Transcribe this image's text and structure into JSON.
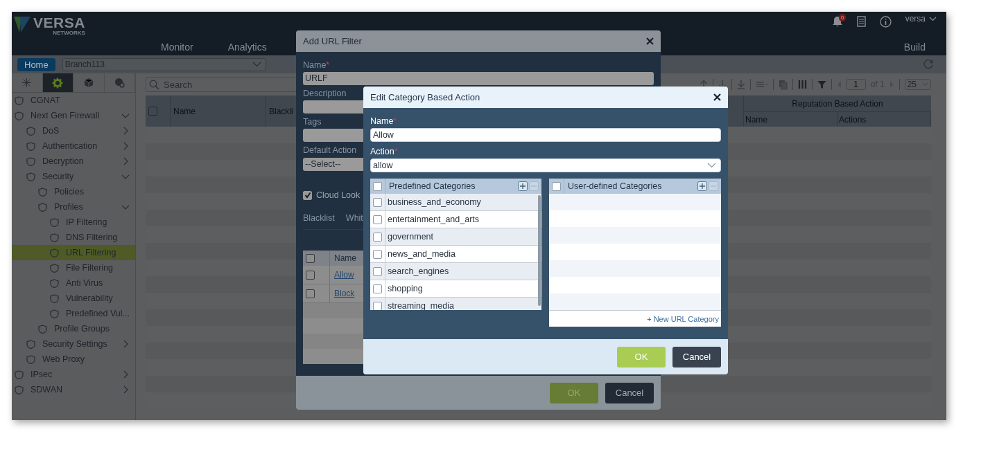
{
  "header": {
    "logo": {
      "wordmark": "VERSA",
      "tagline": "NETWORKS"
    },
    "nav": [
      "Monitor",
      "Analytics"
    ],
    "nav_end": "Build",
    "notifications": "0",
    "user": "versa"
  },
  "toolbar": {
    "home": "Home",
    "branch": "Branch113"
  },
  "sidebar": {
    "tabs": [
      {
        "kind": "network",
        "selected": false
      },
      {
        "kind": "gear",
        "selected": true
      },
      {
        "kind": "cube",
        "selected": false
      },
      {
        "kind": "globe",
        "selected": false
      }
    ],
    "items": [
      {
        "label": "CGNAT",
        "selected": false
      },
      {
        "label": "Next Gen Firewall",
        "selected": false,
        "expanded": true,
        "children": [
          {
            "label": "DoS",
            "selected": false,
            "expanded": false
          },
          {
            "label": "Authentication",
            "selected": false,
            "expanded": false
          },
          {
            "label": "Decryption",
            "selected": false,
            "expanded": false
          },
          {
            "label": "Security",
            "selected": false,
            "expanded": true,
            "children": [
              {
                "label": "Policies",
                "selected": false
              },
              {
                "label": "Profiles",
                "selected": false,
                "expanded": true,
                "children": [
                  {
                    "label": "IP Filtering",
                    "selected": false
                  },
                  {
                    "label": "DNS Filtering",
                    "selected": false
                  },
                  {
                    "label": "URL Filtering",
                    "selected": true
                  },
                  {
                    "label": "File Filtering",
                    "selected": false
                  },
                  {
                    "label": "Anti Virus",
                    "selected": false
                  },
                  {
                    "label": "Vulnerability",
                    "selected": false
                  },
                  {
                    "label": "Predefined Vul...",
                    "selected": false
                  }
                ]
              },
              {
                "label": "Profile Groups",
                "selected": false
              }
            ]
          },
          {
            "label": "Security Settings",
            "selected": false,
            "expanded": false
          },
          {
            "label": "Web Proxy",
            "selected": false
          }
        ]
      },
      {
        "label": "IPsec",
        "selected": false,
        "expanded": false
      },
      {
        "label": "SDWAN",
        "selected": false,
        "expanded": false
      }
    ]
  },
  "content": {
    "search": {
      "placeholder": "Search"
    },
    "pager": {
      "page": "1",
      "of": "of 1",
      "page_size": "25"
    },
    "table": {
      "checked": false,
      "columns": [
        "Name",
        "Blackli"
      ],
      "group": {
        "title": "Reputation Based Action",
        "columns": [
          "Name",
          "Actions"
        ]
      }
    }
  },
  "add_dialog": {
    "title": "Add URL Filter",
    "name": {
      "label": "Name",
      "mark": "*",
      "value": "URLF"
    },
    "description": {
      "label": "Description"
    },
    "tags": {
      "label": "Tags"
    },
    "default_action": {
      "label": "Default Action",
      "value": "--Select--"
    },
    "cloud_lookup": {
      "label": "Cloud Look",
      "checked": true
    },
    "tabs": [
      {
        "label": "Blacklist"
      },
      {
        "label": "Whit"
      }
    ],
    "table": {
      "header": "Name",
      "checked": false,
      "rows": [
        {
          "name": "Allow",
          "checked": false
        },
        {
          "name": "Block",
          "checked": false
        }
      ]
    },
    "ok": "OK",
    "cancel": "Cancel"
  },
  "edit_dialog": {
    "title": "Edit Category Based Action",
    "name": {
      "label": "Name",
      "mark": "*",
      "value": "Allow"
    },
    "action": {
      "label": "Action",
      "mark": "*",
      "value": "allow"
    },
    "predefined": {
      "title": "Predefined Categories",
      "checked": false,
      "rows": [
        {
          "label": "business_and_economy",
          "checked": false
        },
        {
          "label": "entertainment_and_arts",
          "checked": false
        },
        {
          "label": "government",
          "checked": false
        },
        {
          "label": "news_and_media",
          "checked": false
        },
        {
          "label": "search_engines",
          "checked": false
        },
        {
          "label": "shopping",
          "checked": false
        },
        {
          "label": "streaming_media",
          "checked": false
        }
      ]
    },
    "user_defined": {
      "title": "User-defined Categories",
      "checked": false,
      "link": "+ New URL Category"
    },
    "ok": "OK",
    "cancel": "Cancel"
  }
}
